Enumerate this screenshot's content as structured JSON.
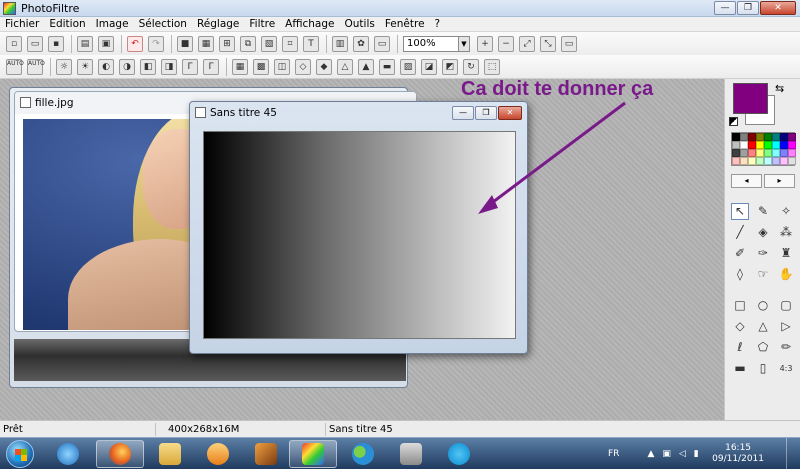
{
  "app": {
    "title": "PhotoFiltre"
  },
  "window_buttons": {
    "minimize": "—",
    "maximize": "❐",
    "close": "✕"
  },
  "menu": [
    "Fichier",
    "Edition",
    "Image",
    "Sélection",
    "Réglage",
    "Filtre",
    "Affichage",
    "Outils",
    "Fenêtre",
    "?"
  ],
  "toolbar": {
    "zoom_value": "100%",
    "text_tool": "T",
    "auto1": "AUTO",
    "auto2": "AUTO"
  },
  "documents": {
    "photo": {
      "title": "fille.jpg"
    },
    "gradient": {
      "title": "Sans titre 45"
    }
  },
  "annotation": {
    "text": "Ca doit te donner ça",
    "color": "#7a1a8a"
  },
  "palette": {
    "foreground": "#800080",
    "background": "#ffffff",
    "swatches": [
      "#000000",
      "#808080",
      "#800000",
      "#808000",
      "#008000",
      "#008080",
      "#000080",
      "#800080",
      "#c0c0c0",
      "#ffffff",
      "#ff0000",
      "#ffff00",
      "#00ff00",
      "#00ffff",
      "#0000ff",
      "#ff00ff",
      "#404040",
      "#a0a0a0",
      "#ff8080",
      "#ffff80",
      "#80ff80",
      "#80ffff",
      "#8080ff",
      "#ff80ff",
      "#ffc0c0",
      "#ffe0c0",
      "#ffffc0",
      "#c0ffc0",
      "#c0ffff",
      "#c0c0ff",
      "#ffc0ff",
      "#e0e0e0"
    ],
    "nav_prev": "◂",
    "nav_next": "▸"
  },
  "tools": [
    "pointer-icon",
    "eyedropper-icon",
    "magic-wand-icon",
    "line-icon",
    "fill-bucket-icon",
    "spray-icon",
    "brush-icon",
    "advanced-brush-icon",
    "stamp-icon",
    "drop-icon",
    "smudge-icon",
    "hand-icon",
    "rectangle-icon",
    "ellipse-icon",
    "rounded-rect-icon",
    "diamond-icon",
    "triangle-icon",
    "arrow-shape-icon",
    "lasso-icon",
    "polygon-icon",
    "pencil-icon",
    "equal-icon",
    "fit-icon",
    "ratio-icon"
  ],
  "tool_labels": {
    "ratio": "4:3"
  },
  "status": {
    "ready": "Prêt",
    "size": "400x268x16M",
    "doc": "Sans titre 45"
  },
  "taskbar": {
    "language": "FR",
    "time": "16:15",
    "date": "09/11/2011"
  },
  "accent_colors": {
    "taskbar": "#1f3a5e",
    "close_button": "#c8462e"
  }
}
